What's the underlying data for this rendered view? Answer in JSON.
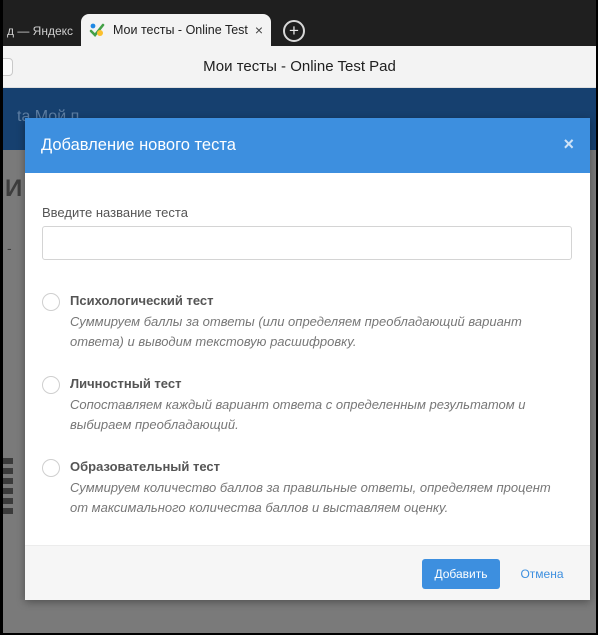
{
  "browser": {
    "inactive_tab_label": "д — Яндекс",
    "active_tab_title": "Мои тесты - Online Test",
    "active_tab_close": "×",
    "new_tab": "+",
    "window_title": "Мои тесты - Online Test Pad"
  },
  "background_page": {
    "header_text": "ta  Мой п",
    "letter": "И",
    "dash": "-"
  },
  "modal": {
    "title": "Добавление нового теста",
    "close_glyph": "×",
    "name_label": "Введите название теста",
    "name_value": "",
    "options": [
      {
        "title": "Психологический тест",
        "description": "Суммируем баллы за ответы (или определяем преобладающий вариант ответа) и выводим текстовую расшифровку."
      },
      {
        "title": "Личностный тест",
        "description": "Сопоставляем каждый вариант ответа с определенным результатом и выбираем преобладающий."
      },
      {
        "title": "Образовательный тест",
        "description": "Суммируем количество баллов за правильные ответы, определяем процент от максимального количества баллов и выставляем оценку."
      }
    ],
    "add_button": "Добавить",
    "cancel_button": "Отмена"
  },
  "colors": {
    "accent": "#3d8fdf",
    "page_header": "#16406f",
    "overlay": "#7a7a7a"
  }
}
